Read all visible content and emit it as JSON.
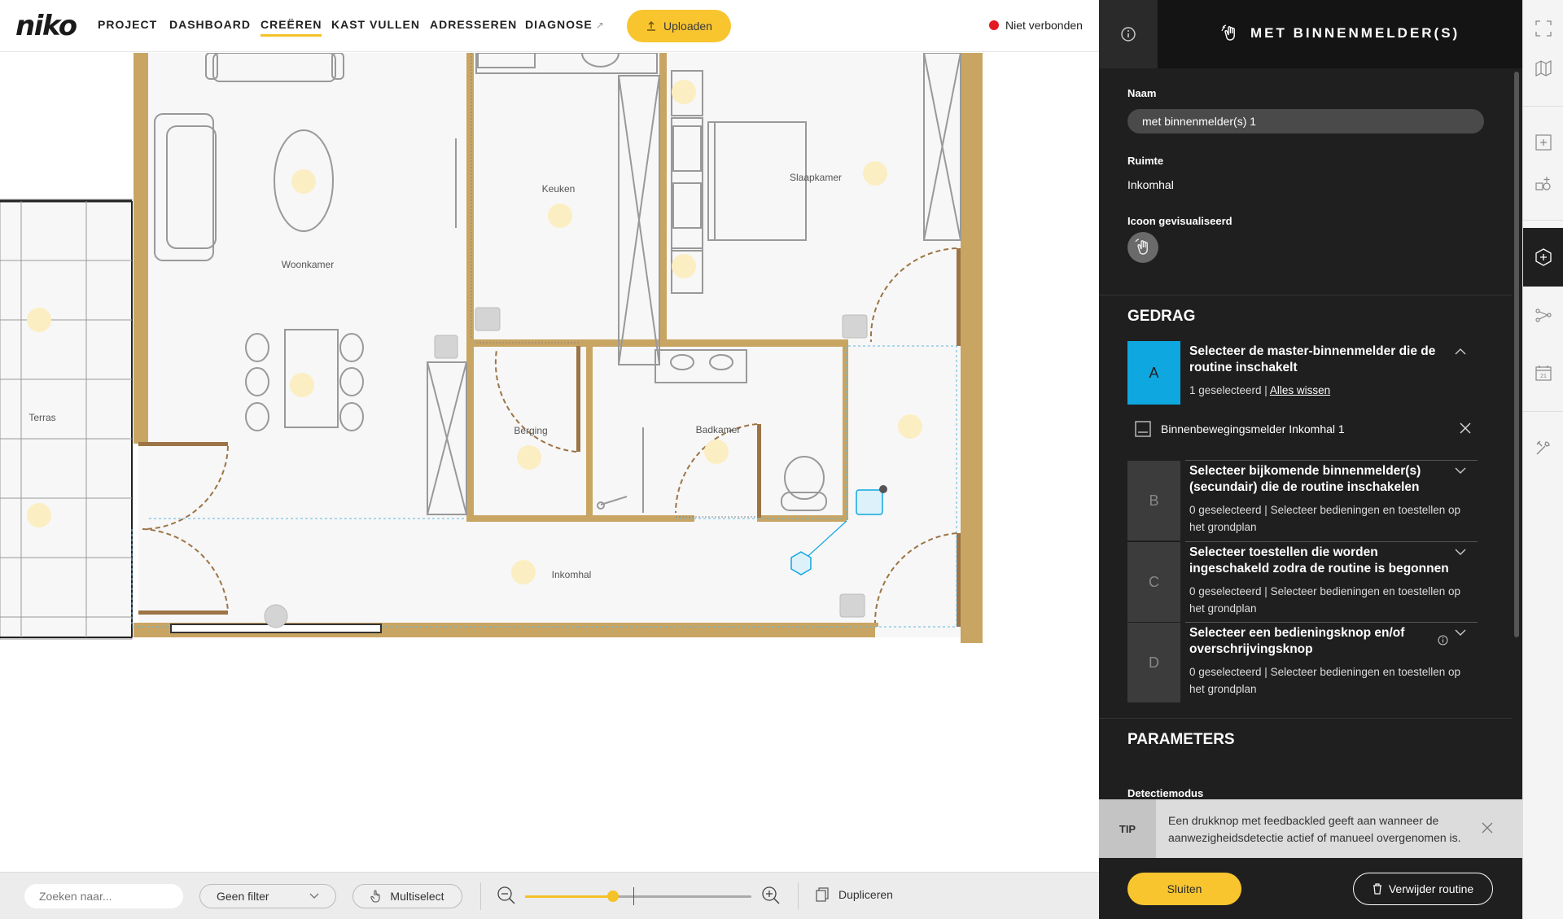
{
  "app": {
    "logo": "niko"
  },
  "nav": {
    "items": [
      {
        "label": "PROJECT",
        "active": false
      },
      {
        "label": "DASHBOARD",
        "active": false
      },
      {
        "label": "CREËREN",
        "active": true
      },
      {
        "label": "KAST VULLEN",
        "active": false
      },
      {
        "label": "ADRESSEREN",
        "active": false
      },
      {
        "label": "DIAGNOSE",
        "active": false,
        "external": true
      }
    ],
    "upload_label": "Uploaden",
    "connection_status": "Niet verbonden",
    "connection_color": "#e21b23"
  },
  "floorplan": {
    "rooms": [
      "Woonkamer",
      "Keuken",
      "Slaapkamer",
      "Terras",
      "Berging",
      "Badkamer",
      "Inkomhal"
    ]
  },
  "toolbar": {
    "search_placeholder": "Zoeken naar...",
    "filter_value": "Geen filter",
    "multiselect_label": "Multiselect",
    "zoom_level": 0.39,
    "duplicate_label": "Dupliceren"
  },
  "panel": {
    "title": "MET BINNENMELDER(S)",
    "name_label": "Naam",
    "name_value": "met binnenmelder(s) 1",
    "room_label": "Ruimte",
    "room_value": "Inkomhal",
    "icon_label": "Icoon gevisualiseerd",
    "behaviour_title": "GEDRAG",
    "steps": [
      {
        "letter": "A",
        "title": "Selecteer de master-binnenmelder die de routine inschakelt",
        "count": "1 geselecteerd | ",
        "action": "Alles wissen",
        "expanded": true
      },
      {
        "letter": "B",
        "title": "Selecteer bijkomende binnenmelder(s) (secundair) die de routine inschakelen",
        "count": "0 geselecteerd | Selecteer bedieningen en toestellen op het grondplan"
      },
      {
        "letter": "C",
        "title": "Selecteer toestellen die worden ingeschakeld zodra de routine is begonnen",
        "count": "0 geselecteerd | Selecteer bedieningen en toestellen op het grondplan"
      },
      {
        "letter": "D",
        "title": "Selecteer een bedieningsknop en/of overschrijvingsknop",
        "count": "0 geselecteerd | Selecteer bedieningen en toestellen op het grondplan"
      }
    ],
    "selected_device": "Binnenbewegingsmelder Inkomhal 1",
    "parameters_title": "PARAMETERS",
    "detection_label": "Detectiemodus",
    "tip_label": "TIP",
    "tip_text": "Een drukknop met feedbackled geeft aan wanneer de aanwezigheidsdetectie actief of manueel overgenomen is.",
    "close_label": "Sluiten",
    "delete_label": "Verwijder routine",
    "accent_color": "#0ea7e0",
    "primary_color": "#f8c52f"
  }
}
